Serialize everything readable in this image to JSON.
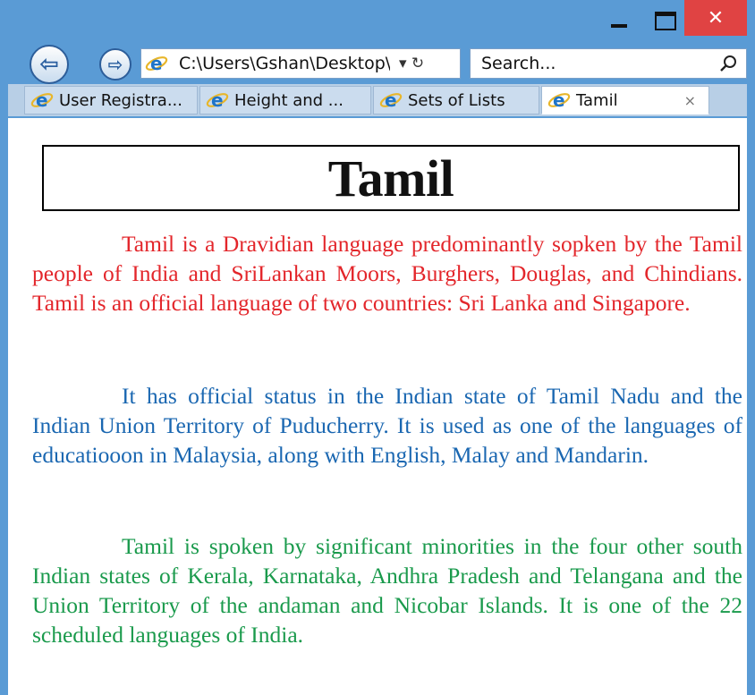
{
  "browser": {
    "address": "C:\\Users\\Gshan\\Desktop\\",
    "address_controls": "▾ ↻",
    "search_placeholder": "Search...",
    "window_controls": {
      "minimize": "—",
      "maximize": "☐",
      "close": "✕"
    }
  },
  "tabs": [
    {
      "label": "User Registra...",
      "active": false
    },
    {
      "label": "Height and ...",
      "active": false
    },
    {
      "label": "Sets of Lists",
      "active": false
    },
    {
      "label": "Tamil",
      "active": true,
      "close": "×"
    }
  ],
  "page": {
    "heading": "Tamil",
    "paragraphs": [
      {
        "text": "Tamil is a Dravidian language predominantly sopken by the Tamil people of India and SriLankan Moors, Burghers, Douglas, and Chindians. Tamil is an official language of two countries: Sri Lanka and Singapore.",
        "color": "#e3262b"
      },
      {
        "text": "It has official status in the Indian state of Tamil Nadu and the Indian Union Territory of Puducherry. It is used as one of the languages of educatiooon in Malaysia, along with English, Malay and Mandarin.",
        "color": "#1a67b1"
      },
      {
        "text": "Tamil is spoken by significant minorities in the four other south Indian states of Kerala, Karnataka, Andhra Pradesh and Telangana and the Union Territory of the andaman and Nicobar Islands. It is one of the 22 scheduled languages of India.",
        "color": "#1a9a4c"
      }
    ]
  },
  "icons": {
    "back": "arrow-left-icon",
    "forward": "arrow-right-icon",
    "ie": "internet-explorer-icon",
    "search": "search-icon",
    "refresh": "refresh-icon"
  },
  "colors": {
    "chrome": "#5a9bd5",
    "close_button": "#e04343"
  }
}
